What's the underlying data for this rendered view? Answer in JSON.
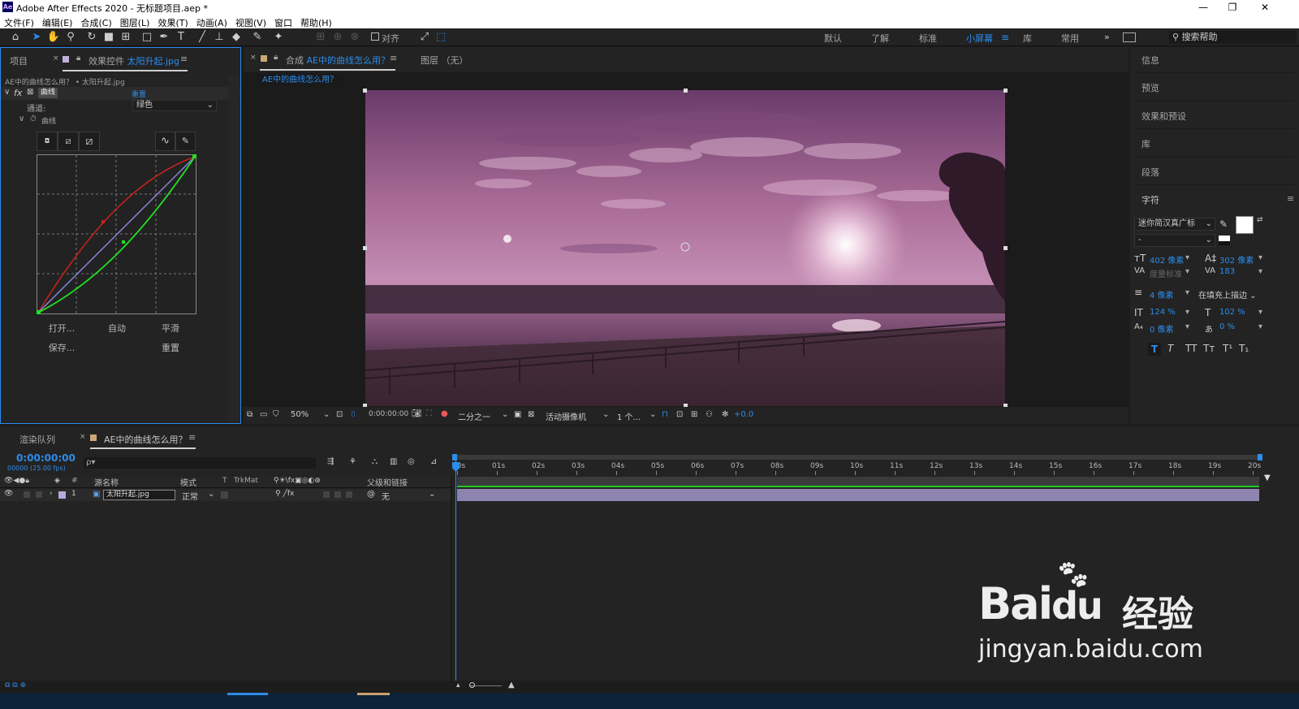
{
  "app": {
    "title": "Adobe After Effects 2020 - 无标题项目.aep *",
    "logo": "Ae"
  },
  "menu": [
    "文件(F)",
    "编辑(E)",
    "合成(C)",
    "图层(L)",
    "效果(T)",
    "动画(A)",
    "视图(V)",
    "窗口",
    "帮助(H)"
  ],
  "toolbar": {
    "align_label": "对齐"
  },
  "workspaces": [
    {
      "label": "默认",
      "active": false
    },
    {
      "label": "了解",
      "active": false
    },
    {
      "label": "标准",
      "active": false
    },
    {
      "label": "小屏幕",
      "active": true
    },
    {
      "label": "库",
      "active": false
    },
    {
      "label": "常用",
      "active": false
    }
  ],
  "search_help": "搜索帮助",
  "left_panel": {
    "tab_project": "项目",
    "tab_effects_prefix": "效果控件",
    "tab_effects_file": "太阳升起.jpg",
    "breadcrumb": "AE中的曲线怎么用？ • 太阳升起.jpg",
    "effect_name": "曲线",
    "reset": "重置",
    "channel_label": "通道:",
    "channel_value": "绿色",
    "curve_label": "曲线",
    "buttons": {
      "open": "打开...",
      "auto": "自动",
      "smooth": "平滑",
      "save": "保存...",
      "reset": "重置"
    }
  },
  "viewer": {
    "tab_comp_prefix": "合成",
    "tab_comp_name": "AE中的曲线怎么用？",
    "tab_layer": "图层 （无）",
    "comp_tab": "AE中的曲线怎么用？",
    "zoom": "50%",
    "timecode": "0:00:00:00",
    "resolution": "二分之一",
    "camera": "活动摄像机",
    "views": "1 个...",
    "exposure": "+0.0"
  },
  "right_panel": {
    "items": [
      "信息",
      "预览",
      "效果和预设",
      "库",
      "段落"
    ],
    "character_title": "字符",
    "font": "迷你简汉真广标",
    "font_style": "-",
    "font_size": "402 像素",
    "leading": "302 像素",
    "kerning": "度量标准",
    "tracking": "183",
    "stroke_width": "4 像素",
    "stroke_type": "在填充上描边",
    "vscale": "124 %",
    "hscale": "102 %",
    "baseline": "0 像素",
    "tsume": "0 %",
    "styles": [
      "T",
      "T",
      "TT",
      "Tт",
      "T¹",
      "T₁"
    ]
  },
  "timeline": {
    "tab_render": "渲染队列",
    "tab_comp": "AE中的曲线怎么用？",
    "timecode": "0:00:00:00",
    "fps": "00000 (25.00 fps)",
    "search_placeholder": "ρ▾",
    "col_hash": "#",
    "col_source": "源名称",
    "col_mode": "模式",
    "col_t": "T",
    "col_trkmat": "TrkMat",
    "col_parent": "父级和链接",
    "layer": {
      "num": "1",
      "name": "太阳升起.jpg",
      "mode": "正常",
      "parent": "无"
    },
    "ruler": [
      "00s",
      "01s",
      "02s",
      "03s",
      "04s",
      "05s",
      "06s",
      "07s",
      "08s",
      "09s",
      "10s",
      "11s",
      "12s",
      "13s",
      "14s",
      "15s",
      "16s",
      "17s",
      "18s",
      "19s",
      "20s"
    ]
  },
  "watermark": {
    "brand": "Bai",
    "brand2": "du",
    "cn": "经验",
    "url": "jingyan.baidu.com"
  },
  "colors": {
    "accent": "#2d8ceb",
    "curve_red": "#c8231e",
    "curve_green": "#22e022",
    "curve_blue": "#8484d8"
  }
}
